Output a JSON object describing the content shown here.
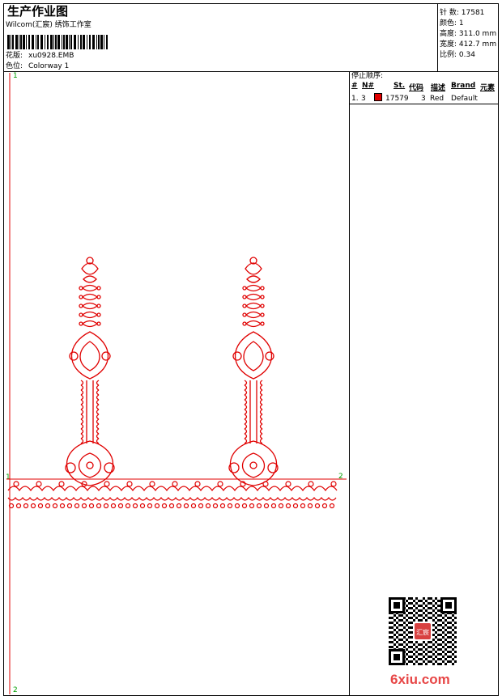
{
  "header": {
    "title": "生产作业图",
    "company": "Wilcom(汇宸) 绣饰工作室",
    "design_label": "花版:",
    "design_value": "xu0928.EMB",
    "colorway_label": "色位:",
    "colorway_value": "Colorway 1"
  },
  "stats": [
    {
      "label": "针 数:",
      "value": "17581"
    },
    {
      "label": "颜色:",
      "value": "1"
    },
    {
      "label": "高度:",
      "value": "311.0 mm"
    },
    {
      "label": "宽度:",
      "value": "412.7 mm"
    },
    {
      "label": "比例:",
      "value": "0.34"
    }
  ],
  "canvas": {
    "marker_1": "1",
    "marker_1_left": "1",
    "marker_2_right": "2",
    "marker_2_bottom": "2",
    "design_color": "#e00000",
    "guide_color": "#e00000"
  },
  "stops": {
    "title": "停止顺序:",
    "columns": [
      "#",
      "N#",
      "St.",
      "代码",
      "描述",
      "Brand",
      "元素"
    ],
    "rows": [
      {
        "num": "1.",
        "needle": "3",
        "swatch": "#e00000",
        "stitches": "17579",
        "code": "3",
        "desc": "Red",
        "brand": "Default",
        "element": ""
      }
    ]
  },
  "watermark": {
    "text": "6xiu.com",
    "stamp": "汇宸"
  }
}
